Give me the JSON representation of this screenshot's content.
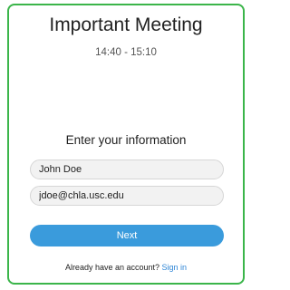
{
  "meeting": {
    "title": "Important Meeting",
    "time_range": "14:40 - 15:10"
  },
  "form": {
    "prompt": "Enter your information",
    "name_value": "John Doe",
    "email_value": "jdoe@chla.usc.edu",
    "next_label": "Next",
    "account_question": "Already have an account?",
    "signin_label": "Sign in"
  },
  "colors": {
    "border_accent": "#3bb54a",
    "button": "#3a9bdc",
    "link": "#2f86d6",
    "field_background": "#f2f2f2"
  }
}
